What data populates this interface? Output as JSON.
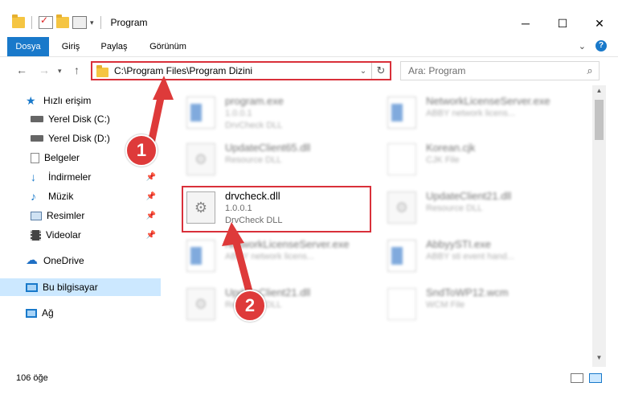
{
  "window": {
    "title": "Program",
    "minimize_glyph": "─",
    "maximize_glyph": "☐",
    "close_glyph": "✕"
  },
  "ribbon": {
    "tabs": [
      {
        "label": "Dosya",
        "active": true
      },
      {
        "label": "Giriş",
        "active": false
      },
      {
        "label": "Paylaş",
        "active": false
      },
      {
        "label": "Görünüm",
        "active": false
      }
    ],
    "help_label": "?"
  },
  "navigation": {
    "address_path": "C:\\Program Files\\Program Dizini",
    "search_placeholder": "Ara: Program"
  },
  "sidebar": {
    "items": [
      {
        "label": "Hızlı erişim",
        "icon": "star-icon"
      },
      {
        "label": "Yerel Disk (C:)",
        "icon": "drive-icon"
      },
      {
        "label": "Yerel Disk (D:)",
        "icon": "drive-icon"
      },
      {
        "label": "Belgeler",
        "icon": "document-icon"
      },
      {
        "label": "İndirmeler",
        "icon": "download-icon"
      },
      {
        "label": "Müzik",
        "icon": "music-icon"
      },
      {
        "label": "Resimler",
        "icon": "pictures-icon"
      },
      {
        "label": "Videolar",
        "icon": "video-icon"
      },
      {
        "label": "OneDrive",
        "icon": "cloud-icon"
      },
      {
        "label": "Bu bilgisayar",
        "icon": "computer-icon"
      },
      {
        "label": "Ağ",
        "icon": "network-icon"
      }
    ]
  },
  "files": [
    {
      "name": "program.exe",
      "version": "1.0.0.1",
      "description": "DrvCheck DLL",
      "icon": "exe-icon"
    },
    {
      "name": "NetworkLicenseServer.exe",
      "version": "ABBY network licens...",
      "description": "",
      "icon": "exe-icon"
    },
    {
      "name": "UpdateClient65.dll",
      "version": "Resource DLL",
      "description": "",
      "icon": "dll-icon"
    },
    {
      "name": "Korean.cjk",
      "version": "CJK File",
      "description": "",
      "icon": "file-icon"
    },
    {
      "name": "drvcheck.dll",
      "version": "1.0.0.1",
      "description": "DrvCheck DLL",
      "icon": "dll-icon"
    },
    {
      "name": "UpdateClient21.dll",
      "version": "Resource DLL",
      "description": "",
      "icon": "dll-icon"
    },
    {
      "name": "NetworkLicenseServer.exe",
      "version": "ABBY network licens...",
      "description": "",
      "icon": "exe-icon"
    },
    {
      "name": "AbbyySTI.exe",
      "version": "ABBY sti event hand...",
      "description": "",
      "icon": "exe-icon"
    },
    {
      "name": "UpdateClient21.dll",
      "version": "Resource DLL",
      "description": "",
      "icon": "dll-icon"
    },
    {
      "name": "SndToWP12.wcm",
      "version": "WCM File",
      "description": "",
      "icon": "file-icon"
    }
  ],
  "status": {
    "item_count": "106 öğe"
  },
  "annotations": {
    "callout_1": "1",
    "callout_2": "2",
    "highlight_color": "#d9303a"
  },
  "colors": {
    "accent": "#1979ca",
    "selection": "#cce8ff"
  }
}
